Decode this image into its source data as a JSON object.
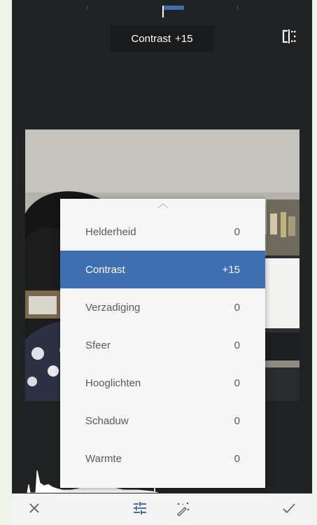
{
  "adjustment": {
    "name": "Contrast",
    "value": "+15",
    "slider_level_fraction": 0.57
  },
  "menu": {
    "items": [
      {
        "label": "Helderheid",
        "value": "0",
        "selected": false
      },
      {
        "label": "Contrast",
        "value": "+15",
        "selected": true
      },
      {
        "label": "Verzadiging",
        "value": "0",
        "selected": false
      },
      {
        "label": "Sfeer",
        "value": "0",
        "selected": false
      },
      {
        "label": "Hooglichten",
        "value": "0",
        "selected": false
      },
      {
        "label": "Schaduw",
        "value": "0",
        "selected": false
      },
      {
        "label": "Warmte",
        "value": "0",
        "selected": false
      }
    ]
  },
  "toolbar": {
    "cancel_icon": "close-icon",
    "tune_icon": "sliders-icon",
    "auto_icon": "magic-wand-icon",
    "apply_icon": "check-icon"
  },
  "colors": {
    "accent": "#3f6fb0",
    "background": "#202223",
    "menu_bg": "#f6f6f6",
    "menu_text": "#5a5a5a"
  }
}
